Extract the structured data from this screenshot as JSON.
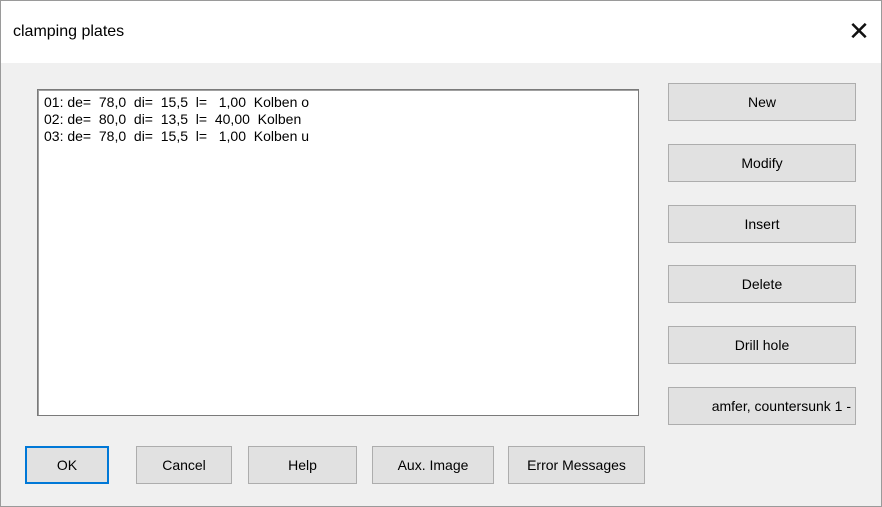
{
  "window": {
    "title": "clamping plates",
    "close_glyph": "✕"
  },
  "list": {
    "items": [
      "01: de=  78,0  di=  15,5  l=   1,00  Kolben o",
      "02: de=  80,0  di=  13,5  l=  40,00  Kolben",
      "03: de=  78,0  di=  15,5  l=   1,00  Kolben u"
    ]
  },
  "side_buttons": {
    "new": "New",
    "modify": "Modify",
    "insert": "Insert",
    "delete": "Delete",
    "drill_hole": "Drill hole",
    "chamfer": "amfer, countersunk  1 -"
  },
  "bottom_buttons": {
    "ok": "OK",
    "cancel": "Cancel",
    "help": "Help",
    "aux_image": "Aux. Image",
    "error_messages": "Error Messages"
  },
  "icons": {
    "close": "close-icon"
  }
}
